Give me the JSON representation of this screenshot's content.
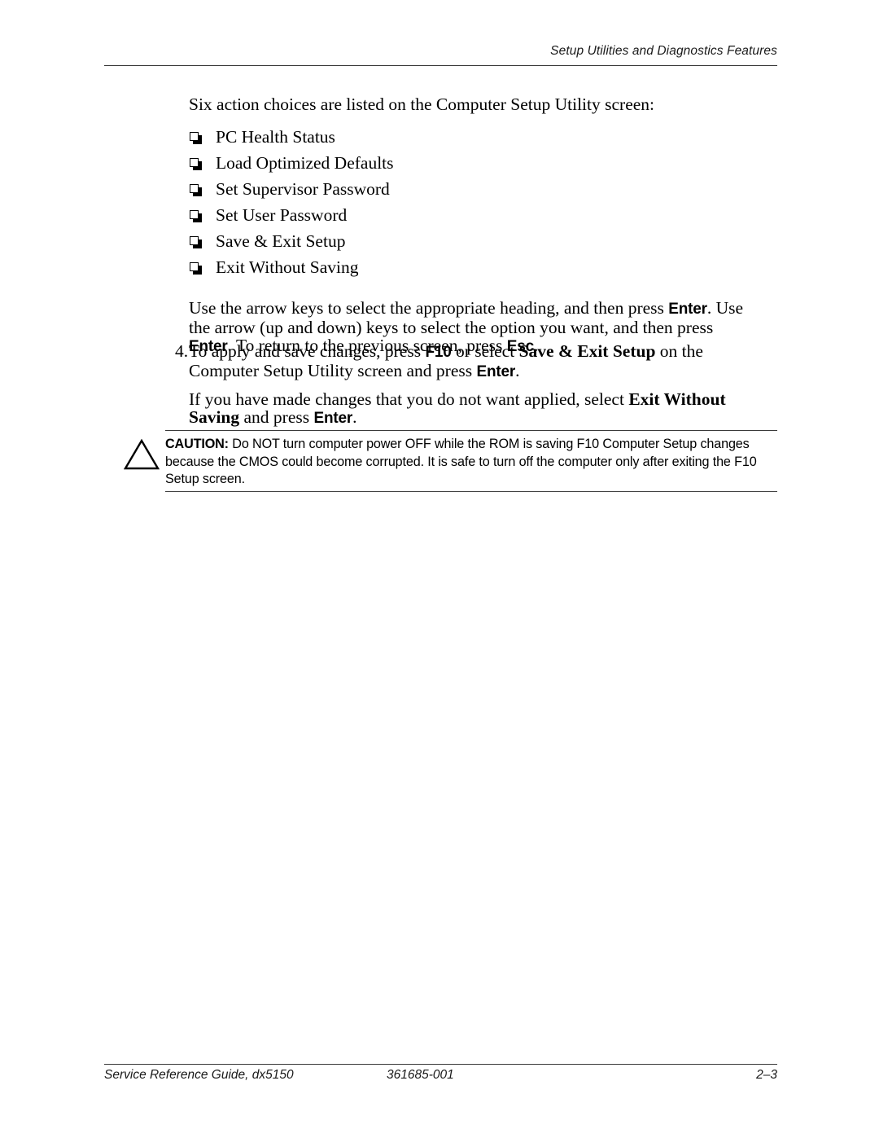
{
  "header": {
    "chapter_title": "Setup Utilities and Diagnostics Features"
  },
  "body": {
    "intro": "Six action choices are listed on the Computer Setup Utility screen:",
    "bullets": [
      {
        "label": "PC Health Status"
      },
      {
        "label": "Load Optimized Defaults"
      },
      {
        "label": "Set Supervisor Password"
      },
      {
        "label": "Set User Password"
      },
      {
        "label": "Save & Exit Setup"
      },
      {
        "label": "Exit Without Saving"
      }
    ],
    "arrow_keys_paragraph": {
      "seg1": "Use the arrow keys to select the appropriate heading, and then press ",
      "key1": "Enter",
      "seg2": ". Use the arrow (up and down) keys to select the option you want, and then press ",
      "key2": "Enter",
      "seg3": ". To return to the previous screen, press ",
      "key3": "Esc",
      "seg4": "."
    },
    "step": {
      "number": "4.",
      "seg1": "To apply and save changes, press ",
      "key1": "F10",
      "seg2": " or select ",
      "menu1": "Save & Exit Setup",
      "seg3": " on the Computer Setup Utility screen and press ",
      "key2": "Enter",
      "seg4": ".",
      "sub_seg1": "If you have made changes that you do not want applied, select ",
      "sub_menu1": "Exit Without Saving",
      "sub_seg2": " and press ",
      "sub_key1": "Enter",
      "sub_seg3": "."
    },
    "caution": {
      "icon": "warning-triangle-icon",
      "label": "CAUTION:",
      "text": " Do NOT turn computer power OFF while the ROM is saving F10 Computer Setup changes because the CMOS could become corrupted. It is safe to turn off the computer only after exiting the F10 Setup screen."
    }
  },
  "footer": {
    "left": "Service Reference Guide, dx5150",
    "center": "361685-001",
    "right": "2–3"
  },
  "colors": {
    "text": "#000000",
    "rule": "#3a3a3a",
    "page_background": "#ffffff"
  }
}
